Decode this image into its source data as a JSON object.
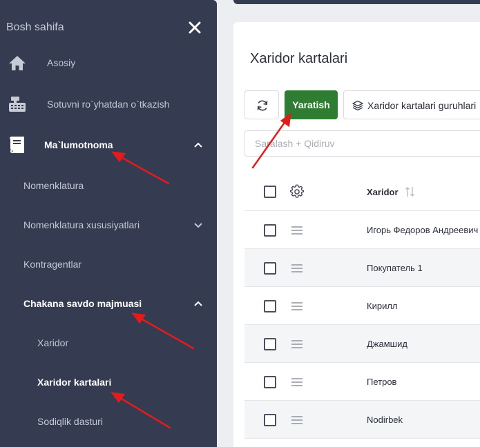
{
  "sidebar": {
    "header_title": "Bosh sahifa",
    "items": [
      {
        "label": "Asosiy"
      },
      {
        "label": "Sotuvni ro`yhatdan o`tkazish"
      },
      {
        "label": "Ma`lumotnoma"
      },
      {
        "label": "Nomenklatura"
      },
      {
        "label": "Nomenklatura xususiyatlari"
      },
      {
        "label": "Kontragentlar"
      },
      {
        "label": "Chakana savdo majmuasi"
      },
      {
        "label": "Xaridor"
      },
      {
        "label": "Xaridor kartalari"
      },
      {
        "label": "Sodiqlik dasturi"
      }
    ]
  },
  "main": {
    "title": "Xaridor kartalari",
    "toolbar": {
      "create_label": "Yaratish",
      "groups_label": "Xaridor kartalari guruhlari"
    },
    "search": {
      "placeholder": "Saralash + Qidiruv",
      "value": ""
    },
    "table": {
      "header": "Xaridor",
      "rows": [
        "Игорь Федоров Андреевич",
        "Покупатель 1",
        "Кирилл",
        "Джамшид",
        "Петров",
        "Nodirbek"
      ]
    }
  },
  "colors": {
    "sidebar_bg": "#353c52",
    "accent_green": "#2e7d32",
    "annotation_red": "#e31b1b"
  }
}
